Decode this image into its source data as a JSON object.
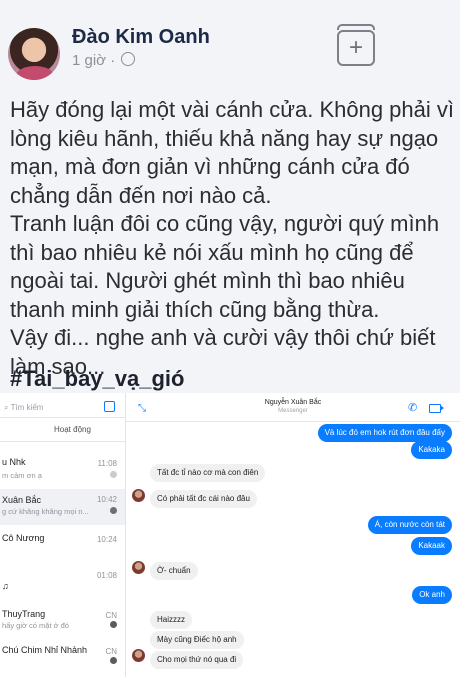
{
  "post": {
    "author": "Đào Kim Oanh",
    "time": "1 giờ ·",
    "paragraphs": [
      "Hãy đóng lại một vài cánh cửa. Không phải vì lòng kiêu hãnh, thiếu khả năng hay sự ngạo mạn, mà đơn giản vì những cánh cửa đó chẳng dẫn đến nơi nào cả.",
      "Tranh luận đôi co cũng vậy, người quý mình thì bao nhiêu kẻ nói xấu mình họ cũng để ngoài tai. Người ghét mình thì bao nhiêu thanh minh giải thích cũng bằng thừa.",
      "Vậy đi... nghe anh và cười vậy thôi chứ biết làm sao..."
    ],
    "hashtag": "#Tai_bay_vạ_gió",
    "save_plus": "+"
  },
  "messenger": {
    "search_placeholder": "Tìm kiếm",
    "tab_active": "Hoạt động",
    "chats": [
      {
        "name": "u Nhk",
        "msg": "m cảm ơn ạ",
        "time": "11:08"
      },
      {
        "name": "Xuân Bắc",
        "msg": "g cứ khăng khăng mọi n...",
        "time": "10:42"
      },
      {
        "name": "Cô Nương",
        "msg": "",
        "time": "10:24"
      },
      {
        "name": "♫",
        "msg": "",
        "time": "01:08"
      },
      {
        "name": "ThuyTrang",
        "msg": "hấy giờ có mặt ở đó",
        "time": "CN"
      },
      {
        "name": "Chú Chim Nhỉ Nhảnh",
        "msg": "",
        "time": "CN"
      }
    ],
    "header_name": "Nguyễn Xuân Bắc",
    "header_sub": "Messenger",
    "messages": [
      {
        "dir": "out",
        "text": "Và lúc đó em hok rút đơn đâu đấy"
      },
      {
        "dir": "out",
        "text": "Kakaka"
      },
      {
        "dir": "in",
        "text": "Tất đc tỉ nào cơ mà con điên"
      },
      {
        "dir": "in",
        "text": "Có phải tất đc cái nào đâu"
      },
      {
        "dir": "out",
        "text": "Á, còn nước còn tát"
      },
      {
        "dir": "out",
        "text": "Kakaak"
      },
      {
        "dir": "in",
        "text": "Ờ- chuẩn"
      },
      {
        "dir": "out",
        "text": "Ok anh"
      },
      {
        "dir": "in",
        "text": "Haizzzz"
      },
      {
        "dir": "in",
        "text": "Mày cũng Điếc hộ anh"
      },
      {
        "dir": "in",
        "text": "Cho mọi thứ nó qua đi"
      }
    ]
  }
}
